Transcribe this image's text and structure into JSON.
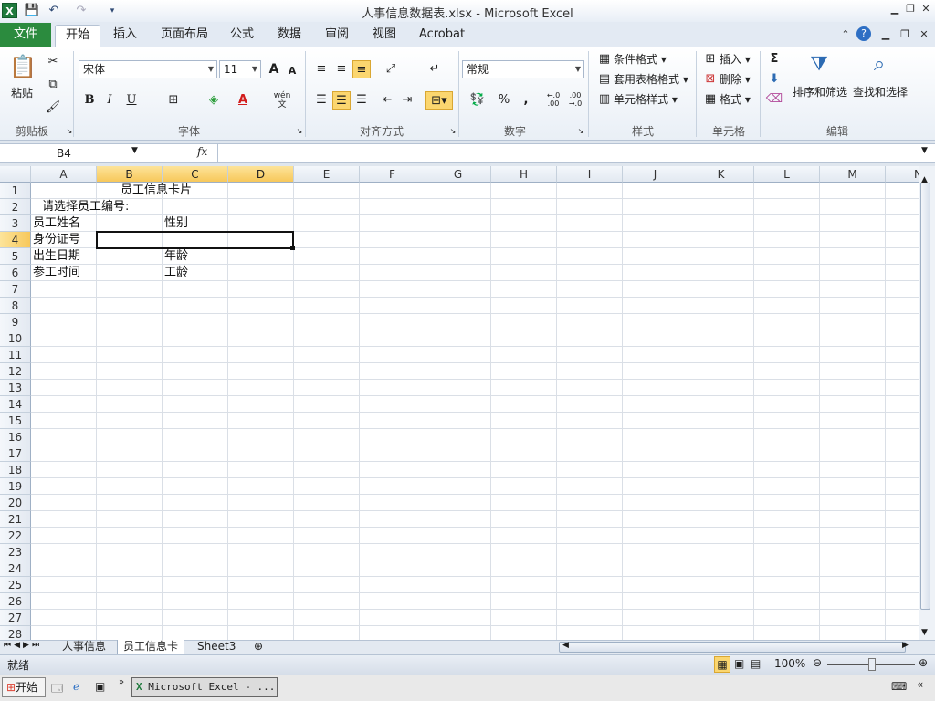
{
  "window": {
    "title": "人事信息数据表.xlsx - Microsoft Excel",
    "app_icon_label": "X"
  },
  "ribbon_tabs": [
    "文件",
    "开始",
    "插入",
    "页面布局",
    "公式",
    "数据",
    "审阅",
    "视图",
    "Acrobat"
  ],
  "active_tab": "开始",
  "clipboard": {
    "paste_label": "粘贴",
    "group_label": "剪贴板"
  },
  "font": {
    "name": "宋体",
    "size": "11",
    "group_label": "字体",
    "bold": "B",
    "italic": "I",
    "underline": "U",
    "grow": "A",
    "shrink": "A",
    "phonetic": "wén 文"
  },
  "alignment": {
    "group_label": "对齐方式"
  },
  "number": {
    "format": "常规",
    "group_label": "数字",
    "percent": "%",
    "comma": ",",
    "inc_decimal": "←.0\n.00",
    "dec_decimal": ".00\n→.0"
  },
  "styles": {
    "conditional": "条件格式",
    "table": "套用表格格式",
    "cell_styles": "单元格样式",
    "group_label": "样式"
  },
  "cells_group": {
    "insert": "插入",
    "delete": "删除",
    "format": "格式",
    "group_label": "单元格"
  },
  "editing": {
    "sigma": "Σ",
    "sort_filter": "排序和筛选",
    "find_select": "查找和选择",
    "group_label": "编辑"
  },
  "formula_bar": {
    "name_box": "B4",
    "fx": "fx",
    "value": ""
  },
  "columns": [
    "A",
    "B",
    "C",
    "D",
    "E",
    "F",
    "G",
    "H",
    "I",
    "J",
    "K",
    "L",
    "M",
    "N"
  ],
  "rows": [
    "1",
    "2",
    "3",
    "4",
    "5",
    "6",
    "7",
    "8",
    "9",
    "10",
    "11",
    "12",
    "13",
    "14",
    "15",
    "16",
    "17",
    "18",
    "19",
    "20",
    "21",
    "22",
    "23",
    "24",
    "25",
    "26",
    "27",
    "28"
  ],
  "cells": {
    "title": "员工信息卡片",
    "prompt": "请选择员工编号:",
    "name_label": "员工姓名",
    "gender_label": "性别",
    "id_label": "身份证号",
    "birth_label": "出生日期",
    "age_label": "年龄",
    "join_label": "参工时间",
    "seniority_label": "工龄"
  },
  "sheets": [
    "人事信息",
    "员工信息卡",
    "Sheet3"
  ],
  "active_sheet": "员工信息卡",
  "status": {
    "ready": "就绪",
    "zoom": "100%"
  },
  "taskbar": {
    "start": "开始",
    "task": "Microsoft Excel - ..."
  }
}
